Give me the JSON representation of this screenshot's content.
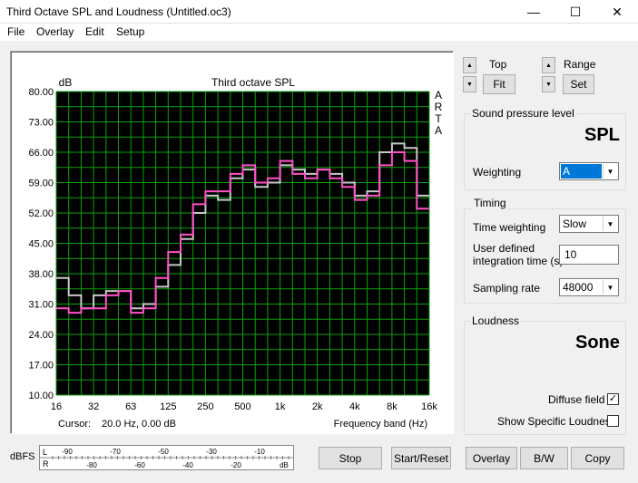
{
  "window": {
    "title": "Third Octave SPL and Loudness (Untitled.oc3)"
  },
  "titlebar_buttons": {
    "minimize": "—",
    "maximize": "☐",
    "close": "✕"
  },
  "menu": [
    "File",
    "Overlay",
    "Edit",
    "Setup"
  ],
  "chart": {
    "title": "Third octave SPL",
    "y_unit": "dB",
    "side_label": [
      "A",
      "R",
      "T",
      "A"
    ],
    "cursor_label": "Cursor:",
    "cursor_value": "20.0 Hz, 0.00 dB",
    "x_caption": "Frequency band (Hz)"
  },
  "chart_data": {
    "type": "line",
    "title": "Third octave SPL",
    "ylabel": "dB",
    "xlabel": "Frequency band (Hz)",
    "ylim": [
      10,
      80
    ],
    "y_ticks": [
      "80.00",
      "73.00",
      "66.00",
      "59.00",
      "52.00",
      "45.00",
      "38.00",
      "31.00",
      "24.00",
      "17.00",
      "10.00"
    ],
    "x_ticks": [
      "16",
      "32",
      "63",
      "125",
      "250",
      "500",
      "1k",
      "2k",
      "4k",
      "8k",
      "16k"
    ],
    "band_count": 30,
    "series": [
      {
        "color": "#c8c8c8",
        "style": "step",
        "values": [
          37,
          33,
          30,
          33,
          34,
          34,
          30,
          31,
          35,
          40,
          46,
          52,
          56,
          55,
          60,
          62,
          58,
          59,
          63,
          62,
          61,
          62,
          61,
          59,
          56,
          57,
          66,
          68,
          67,
          56
        ]
      },
      {
        "color": "#ff50c8",
        "style": "step",
        "values": [
          30,
          29,
          30,
          30,
          33,
          34,
          29,
          30,
          37,
          43,
          47,
          54,
          57,
          57,
          61,
          63,
          59,
          60,
          64,
          61,
          60,
          62,
          60,
          58,
          55,
          56,
          63,
          66,
          64,
          53
        ]
      }
    ],
    "grid": true
  },
  "right_panel": {
    "top_label": "Top",
    "fit_label": "Fit",
    "range_label": "Range",
    "set_label": "Set",
    "spl_group": {
      "title": "Sound pressure level",
      "big_label": "SPL",
      "weighting_label": "Weighting",
      "weighting_value": "A"
    },
    "timing_group": {
      "title": "Timing",
      "time_weighting_label": "Time weighting",
      "time_weighting_value": "Slow",
      "integration_label_1": "User defined",
      "integration_label_2": "integration time (s)",
      "integration_value": "10",
      "sampling_rate_label": "Sampling rate",
      "sampling_rate_value": "48000"
    },
    "loudness_group": {
      "title": "Loudness",
      "big_label": "Sone",
      "diffuse_field_label": "Diffuse field",
      "diffuse_field_checked": "✓",
      "specific_loudness_label": "Show Specific Loudness"
    }
  },
  "bottom": {
    "dbfs_label": "dBFS",
    "meter_L": "L",
    "meter_R": "R",
    "meter_top_ticks": [
      "-90",
      "-70",
      "-50",
      "-30",
      "-10",
      "dB"
    ],
    "meter_bottom_ticks": [
      "-80",
      "-60",
      "-40",
      "-20",
      "dB"
    ],
    "stop_label": "Stop",
    "start_reset_label": "Start/Reset",
    "overlay_label": "Overlay",
    "bw_label": "B/W",
    "copy_label": "Copy"
  }
}
